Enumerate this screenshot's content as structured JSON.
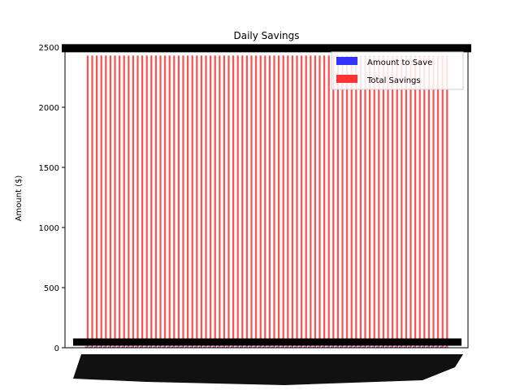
{
  "chart_data": {
    "type": "bar",
    "title": "Daily Savings",
    "xlabel": "",
    "ylabel": "Amount ($)",
    "ylim": [
      0,
      2500
    ],
    "yticks": [
      0,
      500,
      1000,
      1500,
      2000,
      2500
    ],
    "legend_position": "top-right",
    "grid": false,
    "categories_count": 80,
    "series": [
      {
        "name": "Amount to Save",
        "color": "#3333ff",
        "values": [
          10,
          10,
          10,
          10,
          10,
          10,
          10,
          10,
          10,
          10,
          10,
          10,
          10,
          10,
          10,
          10,
          10,
          10,
          10,
          10,
          10,
          10,
          10,
          10,
          10,
          10,
          10,
          10,
          10,
          10,
          10,
          10,
          10,
          10,
          10,
          10,
          10,
          10,
          10,
          10,
          10,
          10,
          10,
          10,
          10,
          10,
          10,
          10,
          10,
          10,
          10,
          10,
          10,
          10,
          10,
          10,
          10,
          10,
          10,
          10,
          10,
          10,
          10,
          10,
          10,
          10,
          10,
          10,
          10,
          10,
          10,
          10,
          10,
          10,
          10,
          10,
          10,
          10,
          10,
          10
        ]
      },
      {
        "name": "Total Savings",
        "color": "#ff3333",
        "values": [
          2430,
          2430,
          2430,
          2430,
          2430,
          2430,
          2430,
          2430,
          2430,
          2430,
          2430,
          2430,
          2430,
          2430,
          2430,
          2430,
          2430,
          2430,
          2430,
          2430,
          2430,
          2430,
          2430,
          2430,
          2430,
          2430,
          2430,
          2430,
          2430,
          2430,
          2430,
          2430,
          2430,
          2430,
          2430,
          2430,
          2430,
          2430,
          2430,
          2430,
          2430,
          2430,
          2430,
          2430,
          2430,
          2430,
          2430,
          2430,
          2430,
          2430,
          2430,
          2430,
          2430,
          2430,
          2430,
          2430,
          2430,
          2430,
          2430,
          2430,
          2430,
          2430,
          2430,
          2430,
          2430,
          2430,
          2430,
          2430,
          2430,
          2430,
          2430,
          2430,
          2430,
          2430,
          2430,
          2430,
          2430,
          2430,
          2430,
          2430
        ]
      }
    ]
  }
}
